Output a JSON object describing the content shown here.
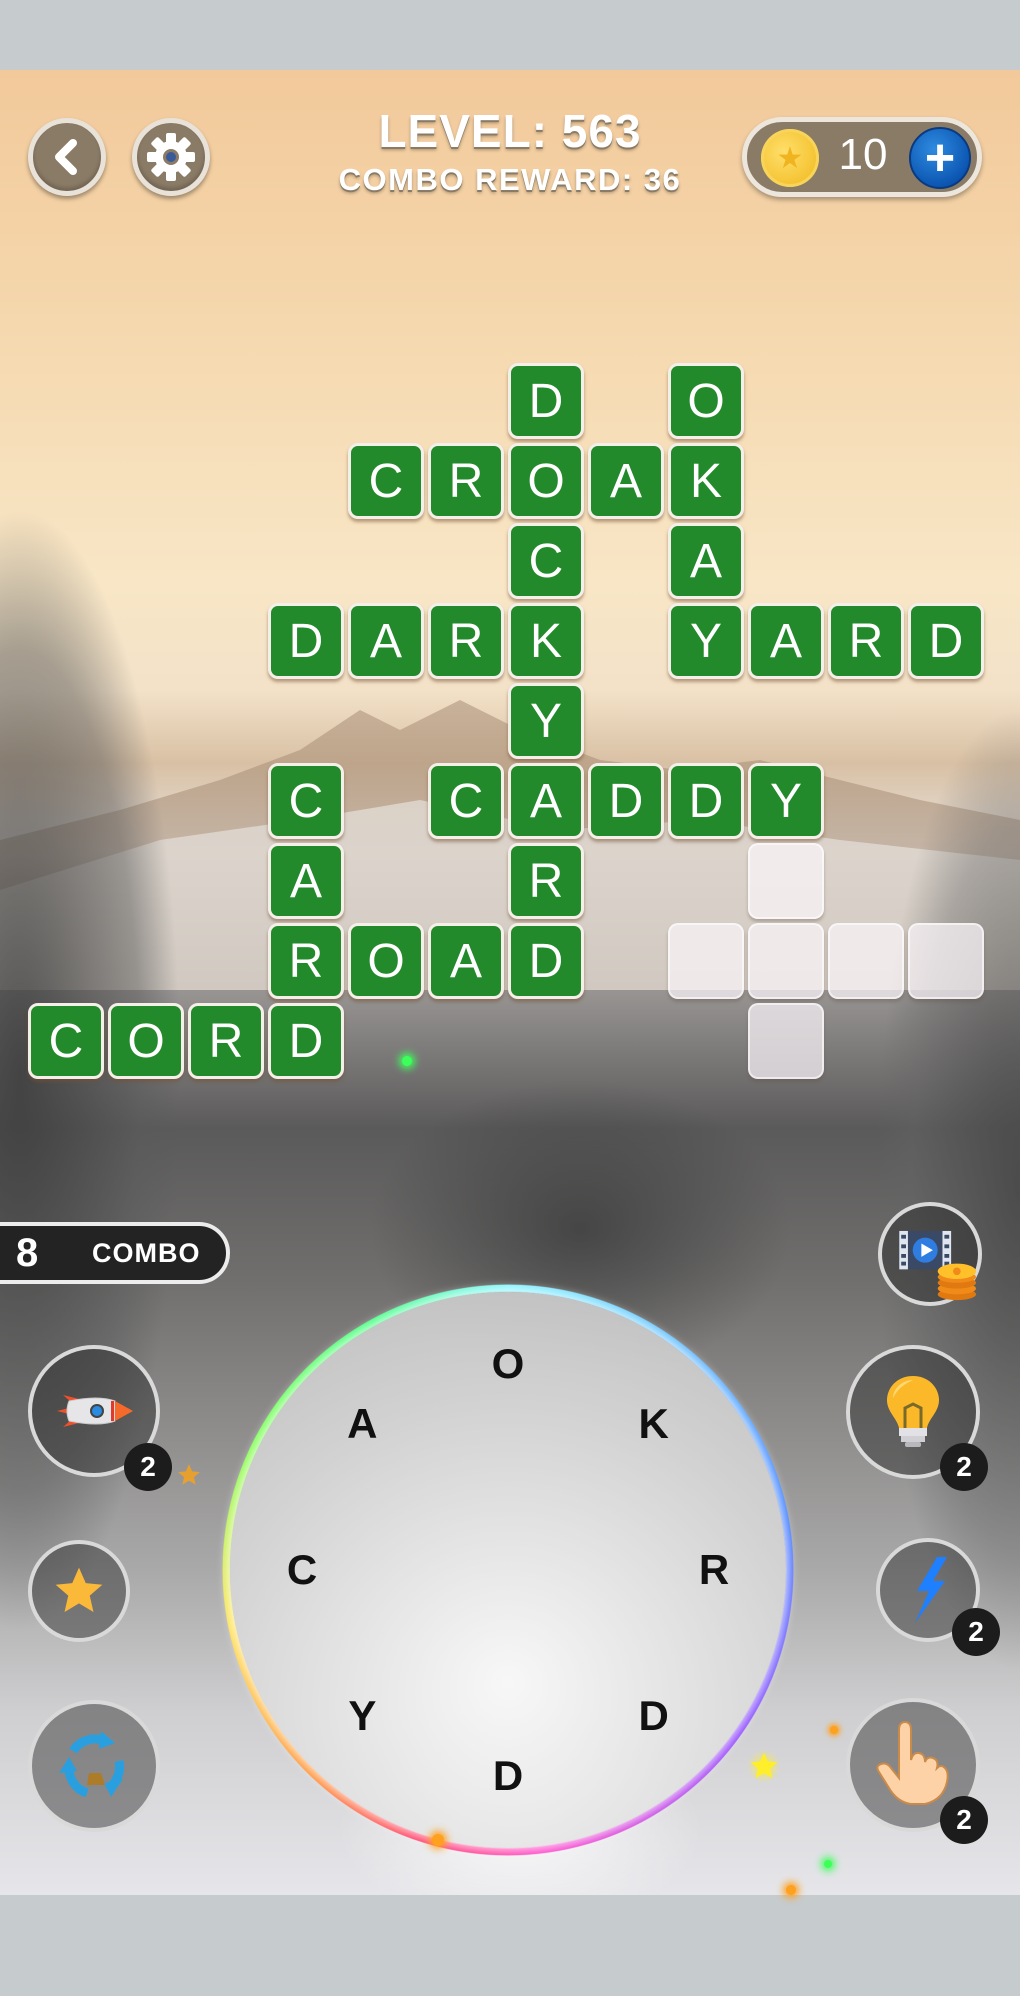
{
  "header": {
    "level_title": "LEVEL: 563",
    "combo_reward": "COMBO REWARD: 36",
    "coins": "10",
    "back_icon": "chevron-left-icon",
    "settings_icon": "gear-icon",
    "coin_icon": "star-coin-icon",
    "add_coins_icon": "plus-icon"
  },
  "colors": {
    "tile_green": "#238a2b",
    "button_brown": "#8a7b66",
    "plus_blue": "#0c57b3",
    "coin_gold": "#f4c230"
  },
  "board": {
    "solved_words": [
      "DOCKY",
      "OKAY",
      "CROAK",
      "DARK",
      "YARD",
      "CADDY",
      "CARD",
      "ROAD",
      "CORD"
    ],
    "tiles": [
      {
        "row": 0,
        "col": 6,
        "letter": "D"
      },
      {
        "row": 0,
        "col": 8,
        "letter": "O"
      },
      {
        "row": 1,
        "col": 4,
        "letter": "C"
      },
      {
        "row": 1,
        "col": 5,
        "letter": "R"
      },
      {
        "row": 1,
        "col": 6,
        "letter": "O"
      },
      {
        "row": 1,
        "col": 7,
        "letter": "A"
      },
      {
        "row": 1,
        "col": 8,
        "letter": "K"
      },
      {
        "row": 2,
        "col": 6,
        "letter": "C"
      },
      {
        "row": 2,
        "col": 8,
        "letter": "A"
      },
      {
        "row": 3,
        "col": 3,
        "letter": "D"
      },
      {
        "row": 3,
        "col": 4,
        "letter": "A"
      },
      {
        "row": 3,
        "col": 5,
        "letter": "R"
      },
      {
        "row": 3,
        "col": 6,
        "letter": "K"
      },
      {
        "row": 3,
        "col": 8,
        "letter": "Y"
      },
      {
        "row": 3,
        "col": 9,
        "letter": "A"
      },
      {
        "row": 3,
        "col": 10,
        "letter": "R"
      },
      {
        "row": 3,
        "col": 11,
        "letter": "D"
      },
      {
        "row": 4,
        "col": 6,
        "letter": "Y"
      },
      {
        "row": 5,
        "col": 3,
        "letter": "C"
      },
      {
        "row": 5,
        "col": 5,
        "letter": "C"
      },
      {
        "row": 5,
        "col": 6,
        "letter": "A"
      },
      {
        "row": 5,
        "col": 7,
        "letter": "D"
      },
      {
        "row": 5,
        "col": 8,
        "letter": "D"
      },
      {
        "row": 5,
        "col": 9,
        "letter": "Y"
      },
      {
        "row": 6,
        "col": 3,
        "letter": "A"
      },
      {
        "row": 6,
        "col": 6,
        "letter": "R"
      },
      {
        "row": 6,
        "col": 9,
        "letter": ""
      },
      {
        "row": 7,
        "col": 3,
        "letter": "R"
      },
      {
        "row": 7,
        "col": 4,
        "letter": "O"
      },
      {
        "row": 7,
        "col": 5,
        "letter": "A"
      },
      {
        "row": 7,
        "col": 6,
        "letter": "D"
      },
      {
        "row": 7,
        "col": 8,
        "letter": ""
      },
      {
        "row": 7,
        "col": 9,
        "letter": ""
      },
      {
        "row": 7,
        "col": 10,
        "letter": ""
      },
      {
        "row": 7,
        "col": 11,
        "letter": ""
      },
      {
        "row": 8,
        "col": 0,
        "letter": "C"
      },
      {
        "row": 8,
        "col": 1,
        "letter": "O"
      },
      {
        "row": 8,
        "col": 2,
        "letter": "R"
      },
      {
        "row": 8,
        "col": 3,
        "letter": "D"
      },
      {
        "row": 8,
        "col": 9,
        "letter": ""
      }
    ]
  },
  "combo": {
    "count": "8",
    "label": "COMBO"
  },
  "boosters": {
    "rocket": {
      "icon": "rocket-icon",
      "count": "2"
    },
    "star": {
      "icon": "star-icon"
    },
    "shuffle": {
      "icon": "shuffle-icon"
    },
    "video": {
      "icon": "video-coins-icon"
    },
    "hint": {
      "icon": "lightbulb-icon",
      "count": "2"
    },
    "bolt": {
      "icon": "lightning-icon",
      "count": "2"
    },
    "finger": {
      "icon": "pointing-finger-icon",
      "count": "2"
    }
  },
  "wheel": {
    "letters": [
      "O",
      "K",
      "R",
      "D",
      "D",
      "Y",
      "C",
      "A"
    ]
  }
}
